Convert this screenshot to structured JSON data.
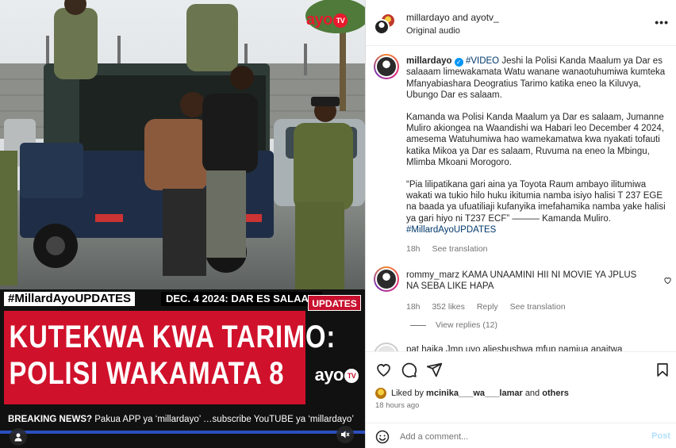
{
  "media": {
    "logo_top": {
      "ayo": "ayo",
      "tv": "TV"
    },
    "logo_bottom": {
      "ayo": "ayo",
      "tv": "TV"
    },
    "hashtag_bar": "#MillardAyoUPDATES",
    "date_bar": "DEC. 4 2024: DAR ES SALAAM",
    "updates_tag": "UPDATES",
    "headline": [
      "KUTEKWA KWA TARIMO:",
      "POLISI WAKAMATA 8"
    ],
    "ticker_prefix": "BREAKING NEWS?",
    "ticker_text": " Pakua APP ya ‘millardayo’ …subscribe YouTUBE ya ‘millardayo’",
    "colors": {
      "headline_red": "#d0112b",
      "progress_blue": "#2a4fbf"
    }
  },
  "header": {
    "names": "millardayo and ayotv_",
    "audio": "Original audio"
  },
  "caption": {
    "username": "millardayo",
    "tag": "#VIDEO",
    "paragraph1": " Jeshi la Polisi Kanda Maalum ya Dar es salaaam limewakamata Watu wanane wanaotuhumiwa kumteka Mfanyabiashara Deogratius Tarimo katika eneo la Kiluvya, Ubungo Dar es salaam.",
    "paragraph2": "Kamanda wa Polisi Kanda Maalum ya Dar es salaam, Jumanne Muliro akiongea na Waandishi wa Habari leo December 4 2024, amesema Watuhumiwa hao wamekamatwa kwa nyakati tofauti katika Mikoa ya Dar es salaam, Ruvuma na eneo la Mbingu, Mlimba Mkoani Morogoro.",
    "paragraph3": "“Pia lilipatikana gari aina ya Toyota Raum ambayo ilitumiwa wakati wa tukio hilo huku ikitumia namba isiyo halisi T 237 EGE na baada ya ufuatiliaji kufanyika imefahamika namba yake halisi ya gari hiyo ni T237 ECF” ——— Kamanda Muliro.",
    "hashtag_footer": "#MillardAyoUPDATES",
    "time": "18h",
    "see_translation": "See translation"
  },
  "comments": [
    {
      "username": "rommy_marz",
      "text": " KAMA UNAAMINI HII NI MOVIE YA JPLUS NA SEBA LIKE HAPA",
      "time": "18h",
      "likes": "352 likes",
      "reply": "Reply",
      "see_translation": "See translation",
      "view_replies": "View replies (12)"
    },
    {
      "username": "pat",
      "text": " haika Jmn uvo aliesbushwa mfup namiua anaitwa"
    }
  ],
  "actions": {
    "liked_prefix": "Liked by ",
    "liked_user": "mcinika___wa___lamar",
    "liked_and": " and ",
    "liked_others": "others",
    "time_ago": "18 hours ago"
  },
  "add_comment": {
    "placeholder": "Add a comment...",
    "post_label": "Post"
  }
}
